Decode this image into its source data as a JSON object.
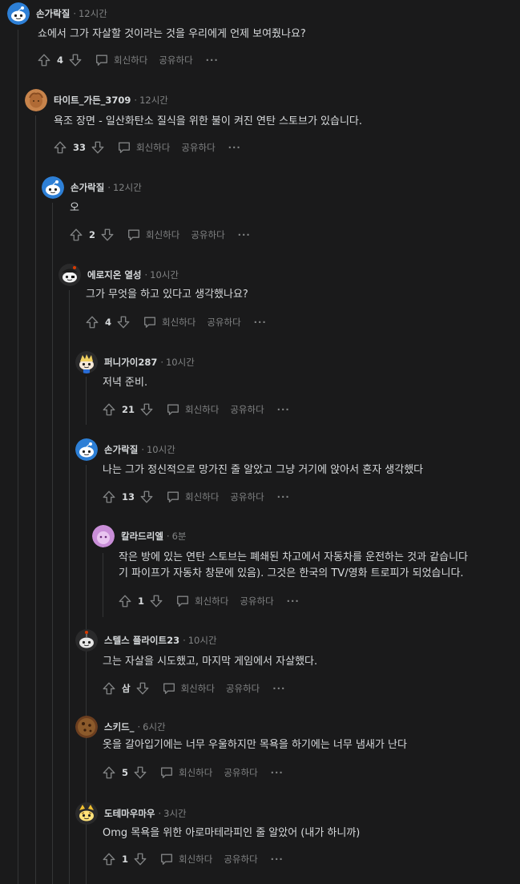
{
  "labels": {
    "reply": "회신하다",
    "share": "공유하다",
    "more": "···"
  },
  "colors": {
    "background": "#1a1a1b",
    "text": "#d7dadc",
    "muted": "#818384",
    "thread_line": "#343536"
  },
  "comments": [
    {
      "author": "손가락질",
      "time": "12시간",
      "avatar": "snoo-blue",
      "body": [
        "쇼에서 그가 자살할 것이라는 것을 우리에게 언제 보여줬나요?"
      ],
      "score": "4"
    },
    {
      "author": "타이트_가든_3709",
      "time": "12시간",
      "avatar": "orange-head",
      "body": [
        "욕조 장면 - 일산화탄소 질식을 위한 불이 켜진 연탄 스토브가 있습니다."
      ],
      "score": "33"
    },
    {
      "author": "손가락질",
      "time": "12시간",
      "avatar": "snoo-blue",
      "body": [
        "오"
      ],
      "score": "2"
    },
    {
      "author": "에로지온 열성",
      "time": "10시간",
      "avatar": "snoo-pirate",
      "body": [
        "그가 무엇을 하고 있다고 생각했나요?"
      ],
      "score": "4"
    },
    {
      "author": "퍼니가이287",
      "time": "10시간",
      "avatar": "snoo-blond",
      "body": [
        "저녁 준비."
      ],
      "score": "21"
    },
    {
      "author": "손가락질",
      "time": "10시간",
      "avatar": "snoo-blue",
      "body": [
        "나는 그가 정신적으로 망가진 줄 알았고 그냥 거기에 앉아서 혼자 생각했다"
      ],
      "score": "13"
    },
    {
      "author": "칼라드리엘",
      "time": "6분",
      "avatar": "pink-ghost",
      "body": [
        "작은 방에 있는 연탄 스토브는 폐쇄된 차고에서 자동차를 운전하는 것과 같습니다",
        "기 파이프가 자동차 창문에 있음). 그것은 한국의 TV/영화 트로피가 되었습니다."
      ],
      "score": "1"
    },
    {
      "author": "스텔스 플라이트23",
      "time": "10시간",
      "avatar": "snoo-gray",
      "body": [
        "그는 자살을 시도했고, 마지막 게임에서 자살했다."
      ],
      "score": "삼"
    },
    {
      "author": "스키드_",
      "time": "6시간",
      "avatar": "cookie",
      "body": [
        "옷을 갈아입기에는 너무 우울하지만 목욕을 하기에는 너무 냄새가 난다"
      ],
      "score": "5"
    },
    {
      "author": "도테마우마우",
      "time": "3시간",
      "avatar": "snoo-tiger",
      "body": [
        "Omg 목욕을 위한 아로마테라피인 줄 알았어 (내가 하니까)"
      ],
      "score": "1"
    }
  ]
}
